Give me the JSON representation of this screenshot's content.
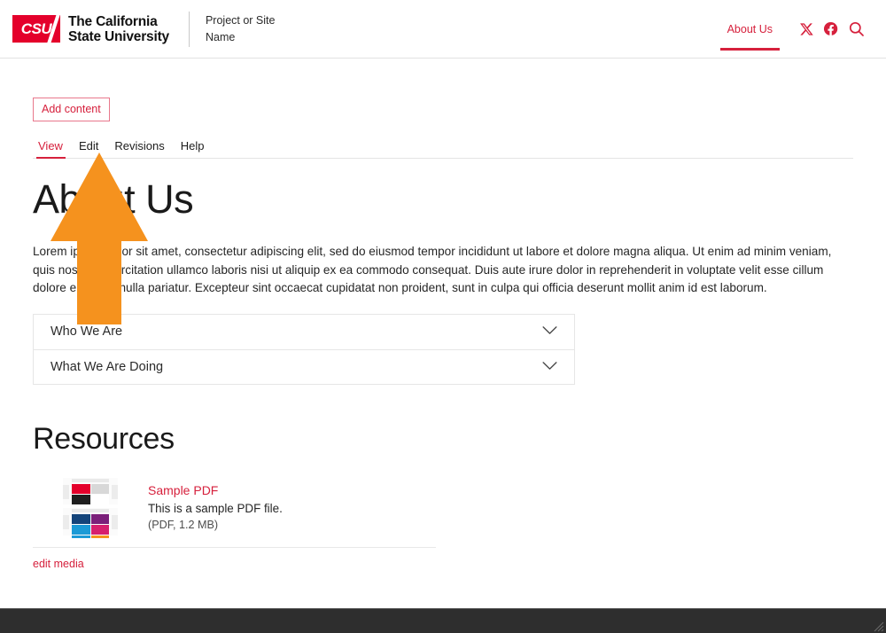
{
  "header": {
    "logo_alt": "CSU",
    "logo_text": "CSU",
    "wordmark_line1": "The California",
    "wordmark_line2": "State University",
    "site_name_line1": "Project or Site",
    "site_name_line2": "Name",
    "nav": [
      {
        "label": "About Us",
        "active": true
      }
    ],
    "social": [
      {
        "name": "x-twitter-icon"
      },
      {
        "name": "facebook-icon"
      },
      {
        "name": "search-icon"
      }
    ]
  },
  "admin": {
    "add_content_label": "Add content",
    "tabs": [
      {
        "label": "View",
        "active": true
      },
      {
        "label": "Edit",
        "active": false
      },
      {
        "label": "Revisions",
        "active": false
      },
      {
        "label": "Help",
        "active": false
      }
    ]
  },
  "main": {
    "page_title": "About Us",
    "paragraph": "Lorem ipsum dolor sit amet, consectetur adipiscing elit, sed do eiusmod tempor incididunt ut labore et dolore magna aliqua. Ut enim ad minim veniam, quis nostrud exercitation ullamco laboris nisi ut aliquip ex ea commodo consequat. Duis aute irure dolor in reprehenderit in voluptate velit esse cillum dolore eu fugiat nulla pariatur. Excepteur sint occaecat cupidatat non proident, sunt in culpa qui officia deserunt mollit anim id est laborum.",
    "accordion": [
      {
        "label": "Who We Are",
        "expanded": false,
        "icon": "chevron-down-icon"
      },
      {
        "label": "What We Are Doing",
        "expanded": false,
        "icon": "chevron-down-icon"
      }
    ]
  },
  "resources": {
    "section_title": "Resources",
    "items": [
      {
        "title": "Sample PDF",
        "description": "This is a sample PDF file.",
        "meta": "(PDF, 1.2 MB)",
        "thumbnail": "pdf-preview-thumbnail"
      }
    ],
    "edit_media_label": "edit media"
  },
  "overlay": {
    "arrow": {
      "name": "orange-up-arrow-annotation",
      "color": "#F5921E",
      "points_to": "Edit tab"
    }
  },
  "colors": {
    "brand_red": "#E4002B",
    "link_red": "#d6203c",
    "accent_orange": "#F5921E",
    "footer_dark": "#2e2e2e",
    "text_dark": "#1a1a1a",
    "border_gray": "#e6e6e6"
  }
}
